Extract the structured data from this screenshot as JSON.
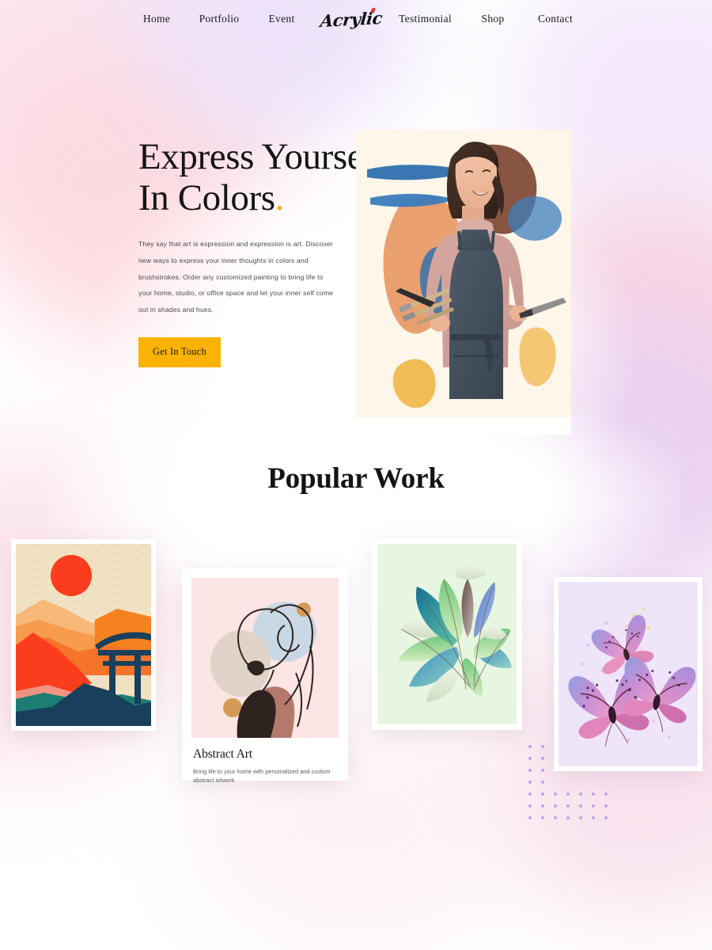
{
  "nav": {
    "brand": "Acrylic",
    "left_items": [
      {
        "label": "Home",
        "name": "nav-link-home"
      },
      {
        "label": "Portfolio",
        "name": "nav-link-portfolio"
      },
      {
        "label": "Event",
        "name": "nav-link-event"
      }
    ],
    "right_items": [
      {
        "label": "Testimonial",
        "name": "nav-link-testimonial"
      },
      {
        "label": "Shop",
        "name": "nav-link-shop"
      },
      {
        "label": "Contact",
        "name": "nav-link-contact"
      }
    ]
  },
  "hero": {
    "title_line1": "Express Yourself",
    "title_line2": "In Colors",
    "title_accent": ".",
    "paragraph": "They say that art is expression and expression is art. Discover new ways to express your inner thoughts in colors and brushstrokes. Order any customized painting to bring life to your home, studio, or office space and let your inner self come out in shades and hues.",
    "cta_label": "Get In Touch",
    "image_alt": "artist-holding-paintbrushes"
  },
  "popular_work": {
    "heading": "Popular Work",
    "cards": [
      {
        "name": "artwork-card-japanese-landscape",
        "alt": "japanese-torii-sunset-landscape-poster"
      },
      {
        "name": "artwork-card-abstract-art",
        "alt": "abstract-line-art-female-portrait",
        "title": "Abstract Art",
        "description": "Bring life to your home with personalized and custom abstract artwork"
      },
      {
        "name": "artwork-card-feathers",
        "alt": "watercolor-feathers-artwork"
      },
      {
        "name": "artwork-card-butterflies",
        "alt": "watercolor-butterflies-artwork"
      }
    ]
  },
  "colors": {
    "accent_amber": "#fbb200",
    "title_accent": "#f5a524",
    "brand_dot_red": "#e23636",
    "dot_grid_purple": "#b9a8e8"
  }
}
